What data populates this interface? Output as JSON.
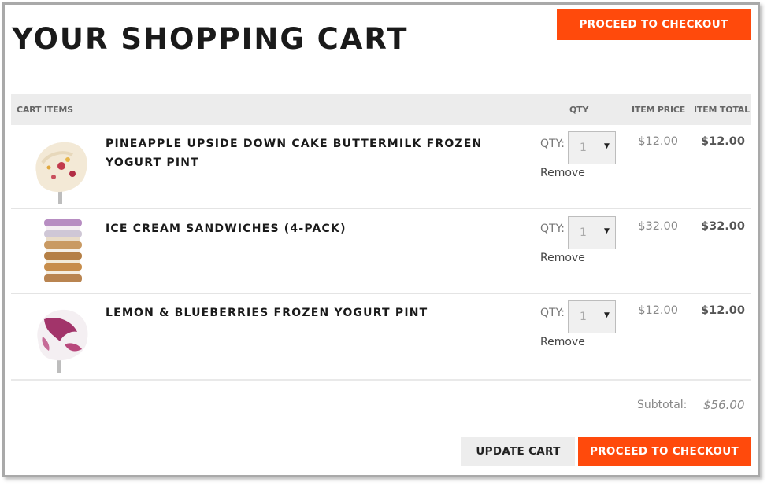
{
  "header": {
    "title": "YOUR SHOPPING CART",
    "checkout_label": "PROCEED TO CHECKOUT"
  },
  "table": {
    "columns": {
      "items": "CART ITEMS",
      "qty": "QTY",
      "price": "ITEM PRICE",
      "total": "ITEM TOTAL"
    },
    "rows": [
      {
        "name": "PINEAPPLE UPSIDE DOWN CAKE BUTTERMILK FROZEN YOGURT PINT",
        "qty_label": "QTY:",
        "qty": "1",
        "remove": "Remove",
        "price": "$12.00",
        "total": "$12.00",
        "image": "pineapple-frozen-yogurt-scoop"
      },
      {
        "name": "ICE CREAM SANDWICHES (4-PACK)",
        "qty_label": "QTY:",
        "qty": "1",
        "remove": "Remove",
        "price": "$32.00",
        "total": "$32.00",
        "image": "ice-cream-sandwich-stack"
      },
      {
        "name": "LEMON & BLUEBERRIES FROZEN YOGURT PINT",
        "qty_label": "QTY:",
        "qty": "1",
        "remove": "Remove",
        "price": "$12.00",
        "total": "$12.00",
        "image": "lemon-blueberry-frozen-yogurt-scoop"
      }
    ]
  },
  "summary": {
    "subtotal_label": "Subtotal:",
    "subtotal_value": "$56.00"
  },
  "footer": {
    "update_label": "UPDATE CART",
    "checkout_label": "PROCEED TO CHECKOUT"
  },
  "colors": {
    "accent": "#ff4a0c",
    "header_bg": "#ececec"
  }
}
